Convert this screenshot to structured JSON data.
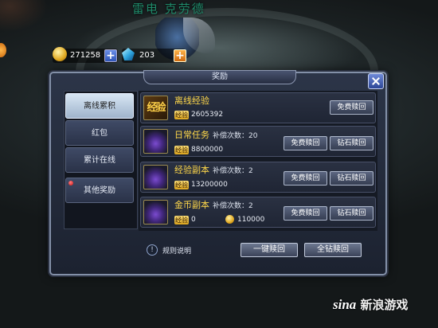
{
  "scene": {
    "character_name": "雷电 克劳德"
  },
  "currency": {
    "gold": "271258",
    "gems": "203"
  },
  "dialog": {
    "title": "奖励",
    "tabs": [
      {
        "label": "离线累积",
        "active": true
      },
      {
        "label": "红包",
        "active": false
      },
      {
        "label": "累计在线",
        "active": false
      },
      {
        "label": "其他奖励",
        "active": false,
        "badge": true
      }
    ],
    "rows": [
      {
        "title": "离线经验",
        "icon": "exp-scroll-icon",
        "exp_tag": "经验",
        "value": "2605392",
        "free_btn": "免费赎回"
      },
      {
        "title": "日常任务",
        "icon": "treasure-chest-icon",
        "compensation_label": "补偿次数：20",
        "exp_tag": "经验",
        "value": "8800000",
        "free_btn": "免费赎回",
        "diamond_btn": "钻石赎回"
      },
      {
        "title": "经验副本",
        "icon": "treasure-chest-icon",
        "compensation_label": "补偿次数：2",
        "exp_tag": "经验",
        "value": "13200000",
        "free_btn": "免费赎回",
        "diamond_btn": "钻石赎回"
      },
      {
        "title": "金币副本",
        "icon": "treasure-chest-icon",
        "compensation_label": "补偿次数：2",
        "exp_tag": "经验",
        "value": "0",
        "gold_value": "110000",
        "free_btn": "免费赎回",
        "diamond_btn": "钻石赎回"
      }
    ],
    "rules_label": "规则说明",
    "one_click_btn": "一键赎回",
    "all_diamond_btn": "全钻赎回"
  },
  "watermark": {
    "brand": "sina",
    "text": "新浪游戏"
  },
  "colors": {
    "accent_gold": "#ffd84a",
    "panel": "#1c2230"
  }
}
